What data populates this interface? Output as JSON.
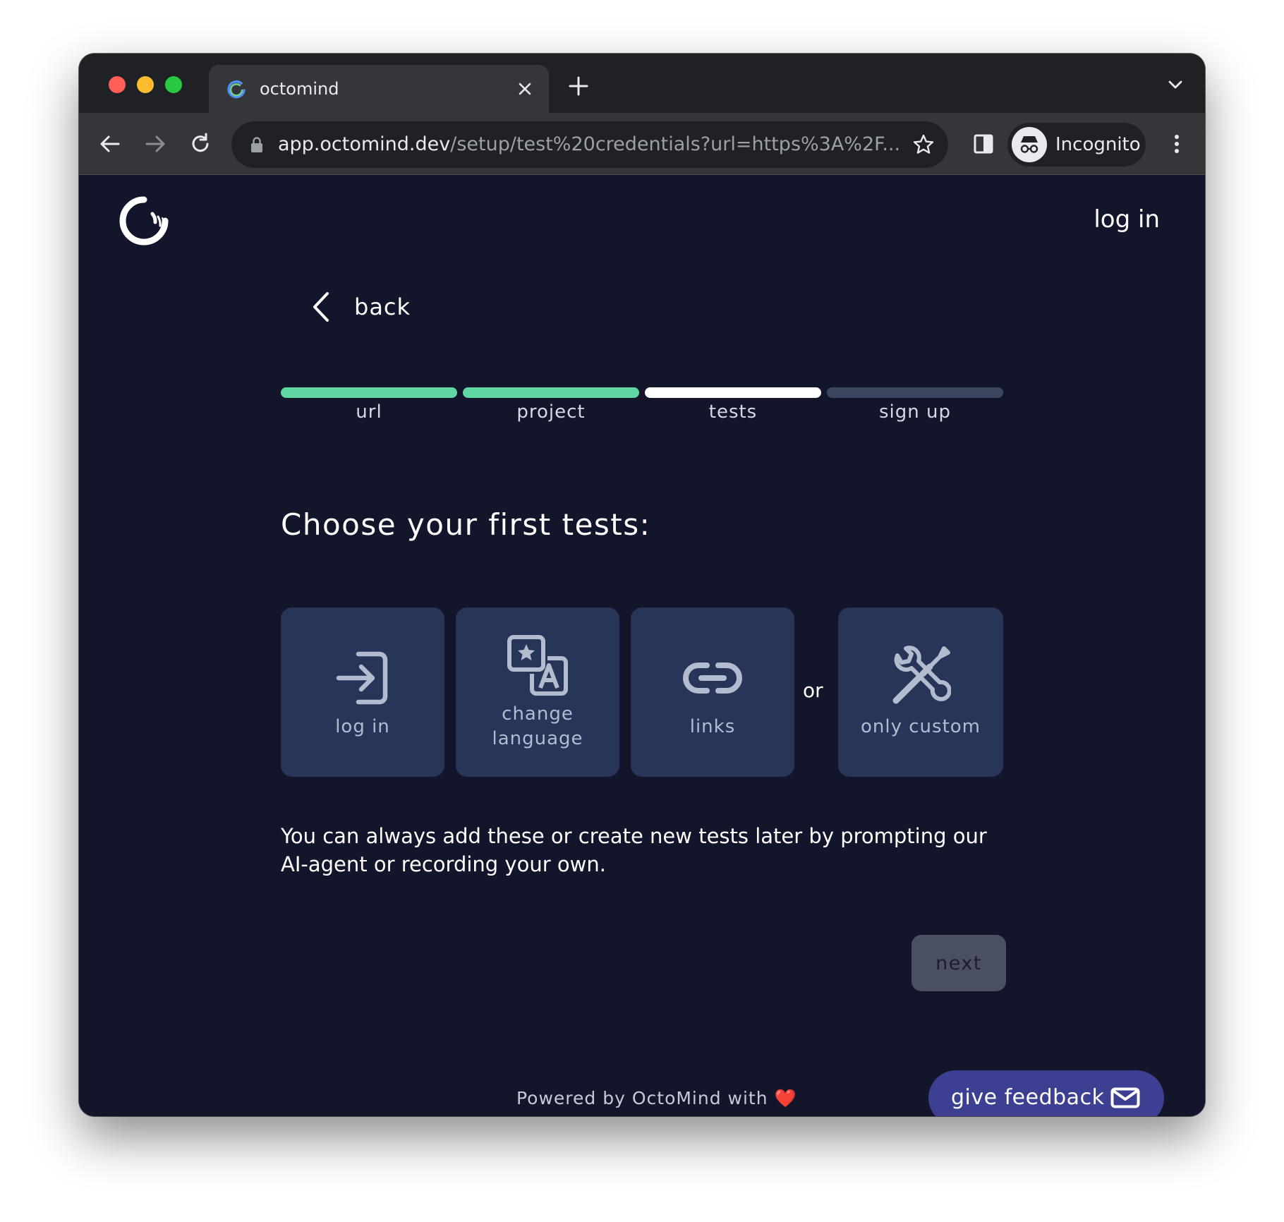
{
  "browser": {
    "tab": {
      "title": "octomind"
    },
    "address_bar": {
      "host": "app.octomind.dev",
      "path": "/setup/test%20credentials?url=https%3A%2F..."
    },
    "profile": {
      "label": "Incognito"
    }
  },
  "header": {
    "login_link": "log in"
  },
  "back": {
    "label": "back"
  },
  "steps": [
    {
      "label": "url",
      "state": "done",
      "color": "#5fd6a4"
    },
    {
      "label": "project",
      "state": "done",
      "color": "#5fd6a4"
    },
    {
      "label": "tests",
      "state": "current",
      "color": "#ffffff"
    },
    {
      "label": "sign up",
      "state": "upcoming",
      "color": "#3b4660"
    }
  ],
  "heading": "Choose your first tests:",
  "test_options": [
    {
      "label_line1": "log in",
      "label_line2": "",
      "icon": "login-icon"
    },
    {
      "label_line1": "change",
      "label_line2": "language",
      "icon": "translate-icon"
    },
    {
      "label_line1": "links",
      "label_line2": "",
      "icon": "link-icon"
    },
    {
      "label_line1": "only custom",
      "label_line2": "",
      "icon": "tools-icon"
    }
  ],
  "or_label": "or",
  "info_text": "You can always add these or create new tests later by prompting our AI-agent or recording your own.",
  "next_button": "next",
  "footer": {
    "powered_text": "Powered by OctoMind with",
    "heart": "❤️"
  },
  "feedback_button": "give feedback",
  "colors": {
    "page_background": "#13152b",
    "card_background": "#263558",
    "step_done": "#5fd6a4",
    "feedback_button": "#3d3f93",
    "next_button_disabled": "#4b4f62"
  }
}
